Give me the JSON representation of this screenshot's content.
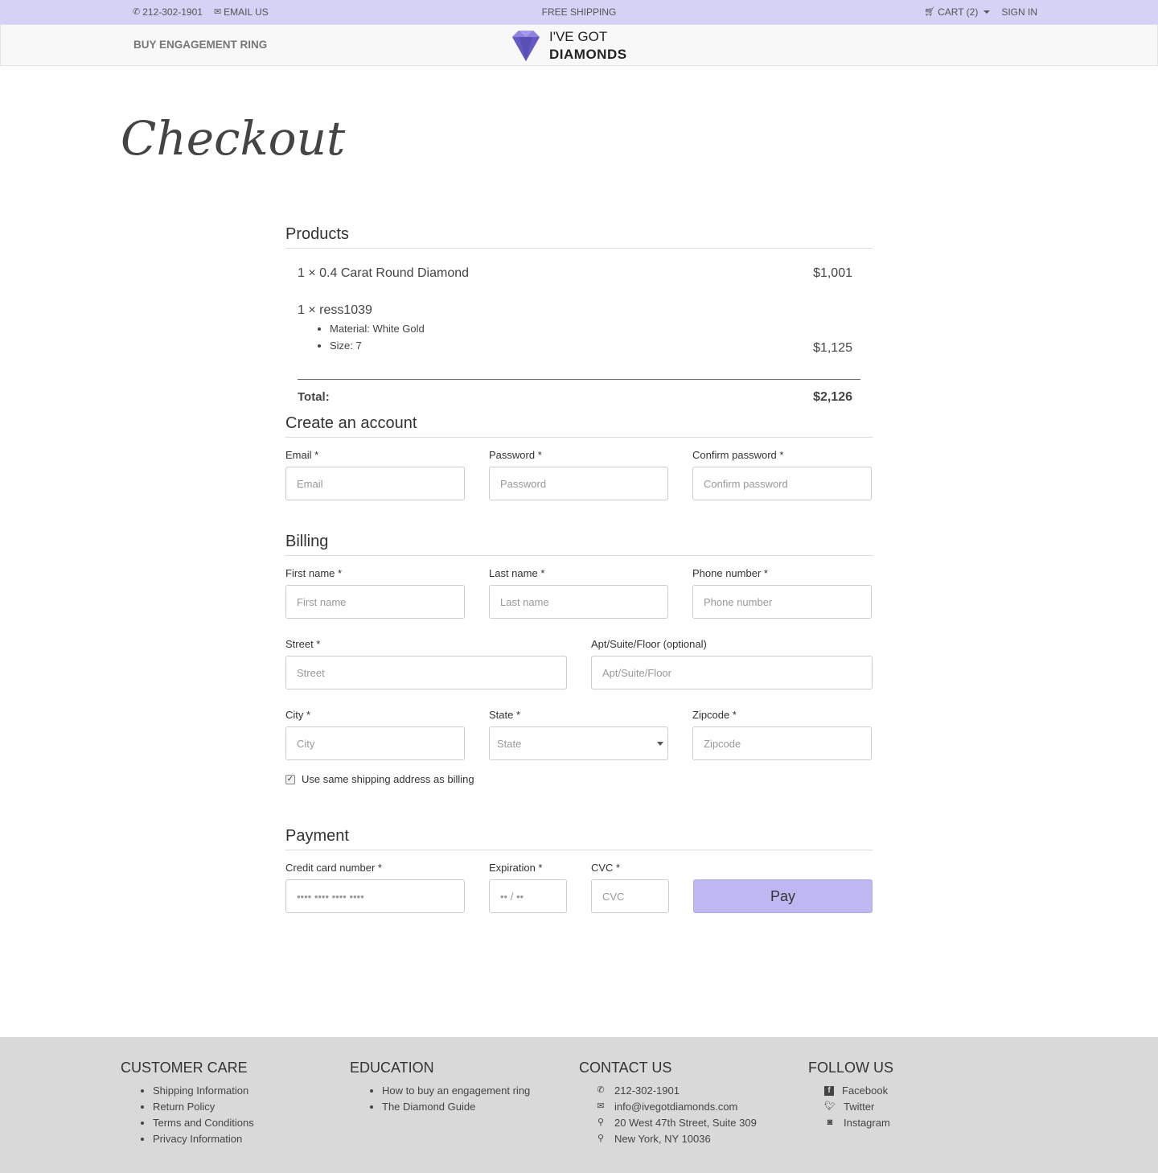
{
  "topbar": {
    "phone": "212-302-1901",
    "email_label": "EMAIL US",
    "center": "FREE SHIPPING",
    "cart": "CART (2)",
    "signin": "SIGN IN"
  },
  "nav": {
    "link": "BUY ENGAGEMENT RING",
    "logo_line1": "I'VE GOT",
    "logo_line2": "DIAMONDS"
  },
  "page_title": "Checkout",
  "products": {
    "title": "Products",
    "items": [
      {
        "name": "1 × 0.4 Carat Round Diamond",
        "price": "$1,001"
      },
      {
        "name": "1 × ress1039",
        "price": "$1,125",
        "details": [
          "Material: White Gold",
          "Size: 7"
        ]
      }
    ],
    "total_label": "Total:",
    "total_value": "$2,126"
  },
  "account": {
    "title": "Create an account",
    "email_label": "Email *",
    "email_placeholder": "Email",
    "password_label": "Password *",
    "password_placeholder": "Password",
    "confirm_label": "Confirm password *",
    "confirm_placeholder": "Confirm password"
  },
  "billing": {
    "title": "Billing",
    "first_label": "First name *",
    "first_placeholder": "First name",
    "last_label": "Last name *",
    "last_placeholder": "Last name",
    "phone_label": "Phone number *",
    "phone_placeholder": "Phone number",
    "street_label": "Street *",
    "street_placeholder": "Street",
    "apt_label": "Apt/Suite/Floor (optional)",
    "apt_placeholder": "Apt/Suite/Floor",
    "city_label": "City *",
    "city_placeholder": "City",
    "state_label": "State *",
    "state_value": "State",
    "zip_label": "Zipcode *",
    "zip_placeholder": "Zipcode",
    "same_shipping": "Use same shipping address as billing",
    "same_shipping_checked": true
  },
  "payment": {
    "title": "Payment",
    "cc_label": "Credit card number *",
    "cc_placeholder": "•••• •••• •••• ••••",
    "exp_label": "Expiration *",
    "exp_placeholder": "•• / ••",
    "cvc_label": "CVC *",
    "cvc_placeholder": "CVC",
    "pay_label": "Pay"
  },
  "footer": {
    "customer_care": {
      "title": "CUSTOMER CARE",
      "items": [
        "Shipping Information",
        "Return Policy",
        "Terms and Conditions",
        "Privacy Information"
      ]
    },
    "education": {
      "title": "EDUCATION",
      "items": [
        "How to buy an engagement ring",
        "The Diamond Guide"
      ]
    },
    "contact": {
      "title": "CONTACT US",
      "phone": "212-302-1901",
      "email": "info@ivegotdiamonds.com",
      "address1": "20 West 47th Street, Suite 309",
      "address2": "New York, NY 10036"
    },
    "follow": {
      "title": "FOLLOW US",
      "items": [
        "Facebook",
        "Twitter",
        "Instagram"
      ]
    }
  },
  "colors": {
    "topbar_bg": "#d4d2f5",
    "accent": "#bdb8f2",
    "footer_bg": "#d9d9d9",
    "logo_purple": "#7b6fd6"
  }
}
